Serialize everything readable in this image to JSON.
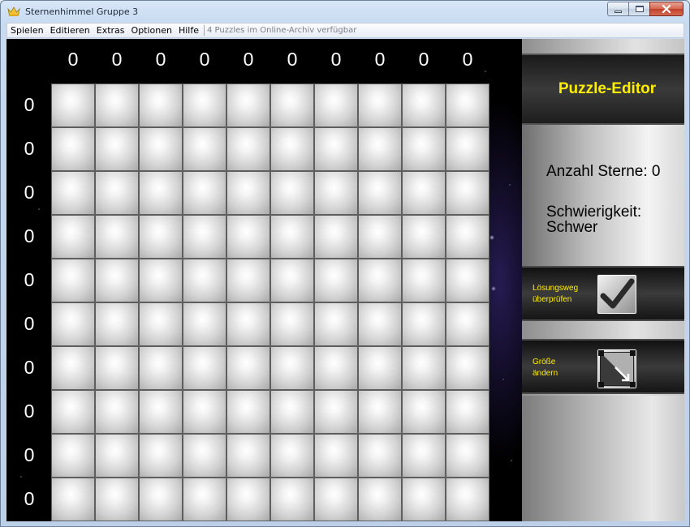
{
  "window": {
    "title": "Sternenhimmel Gruppe 3",
    "icon": "crown-icon",
    "controls": {
      "minimize": "minimize-icon",
      "maximize": "maximize-icon",
      "close": "close-icon"
    }
  },
  "menu": {
    "items": [
      {
        "label": "Spielen"
      },
      {
        "label": "Editieren"
      },
      {
        "label": "Extras"
      },
      {
        "label": "Optionen"
      },
      {
        "label": "Hilfe"
      }
    ],
    "status": "4 Puzzles im Online-Archiv verfügbar"
  },
  "board": {
    "rows": 10,
    "columns": 10,
    "column_counts": [
      "0",
      "0",
      "0",
      "0",
      "0",
      "0",
      "0",
      "0",
      "0",
      "0"
    ],
    "row_counts": [
      "0",
      "0",
      "0",
      "0",
      "0",
      "0",
      "0",
      "0",
      "0",
      "0"
    ]
  },
  "panel": {
    "title": "Puzzle-Editor",
    "stars_label": "Anzahl Sterne: 0",
    "difficulty_label": "Schwierigkeit:",
    "difficulty_value": "Schwer",
    "check_label_line1": "Lösungsweg",
    "check_label_line2": "überprüfen",
    "check_icon": "checkmark-icon",
    "resize_label_line1": "Größe",
    "resize_label_line2": "ändern",
    "resize_icon": "resize-icon"
  },
  "colors": {
    "accent_yellow": "#ffee00",
    "space_black": "#000000",
    "cell_light": "#f4f4f4"
  }
}
